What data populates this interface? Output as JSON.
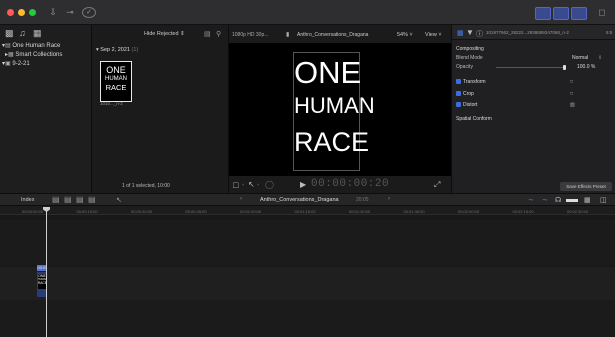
{
  "toolbar": {
    "import_icon": "download-icon",
    "keywords_icon": "key-icon",
    "background_tasks_icon": "checkmark-circle-icon",
    "workspace_buttons": [
      "library-toggle",
      "timeline-toggle",
      "inspector-toggle"
    ]
  },
  "library": {
    "items": [
      {
        "label": "One Human Race",
        "expanded": true,
        "icon": "library-icon"
      },
      {
        "label": "Smart Collections",
        "expanded": false,
        "icon": "folder-icon"
      },
      {
        "label": "9-2-21",
        "expanded": true,
        "icon": "event-icon",
        "selected": true
      }
    ]
  },
  "browser": {
    "filter_label": "Hide Rejected",
    "date_group": "Sep 2, 2021",
    "date_count": "(1)",
    "clip_title_lines": [
      "ONE",
      "HUMAN",
      "RACE"
    ],
    "clip_name": "1010..._n-2",
    "status": "1 of 1 selected, 10:00"
  },
  "viewer": {
    "format": "1080p HD 30p...",
    "project_name": "Anthro_Conversations_Dragana",
    "zoom": "54%",
    "view_label": "View",
    "title_lines": [
      "ONE",
      "HUMAN",
      "RACE"
    ],
    "timecode": "00:00:00:20"
  },
  "inspector": {
    "clip_name": "101977662_28222...2938689347068_n-2",
    "duration": "5:5",
    "compositing_label": "Compositing",
    "blend_mode_label": "Blend Mode",
    "blend_mode_value": "Normal",
    "opacity_label": "Opacity",
    "opacity_value": "100.0 %",
    "opacity_level": 1.0,
    "sections": [
      "Transform",
      "Crop",
      "Distort"
    ],
    "spatial_conform": "Spatial Conform",
    "save_preset": "Save Effects Preset"
  },
  "timeline": {
    "index_label": "Index",
    "project_name": "Anthro_Conversations_Dragana",
    "project_duration": "20:05",
    "ruler_ticks": [
      "00:00:00:00",
      "00:00:15:00",
      "00:00:30:00",
      "00:00:45:00",
      "00:01:00:00",
      "00:01:15:00",
      "00:01:30:00",
      "00:01:45:00",
      "00:02:00:00",
      "00:02:15:00",
      "00:02:30:00"
    ],
    "clip_label": "1019?...",
    "clip_title_lines": [
      "ONE",
      "HUMAN",
      "RACE"
    ]
  },
  "colors": {
    "accent": "#3d6ce0",
    "clip": "#2b3b7a",
    "background": "#1a1a1a"
  }
}
